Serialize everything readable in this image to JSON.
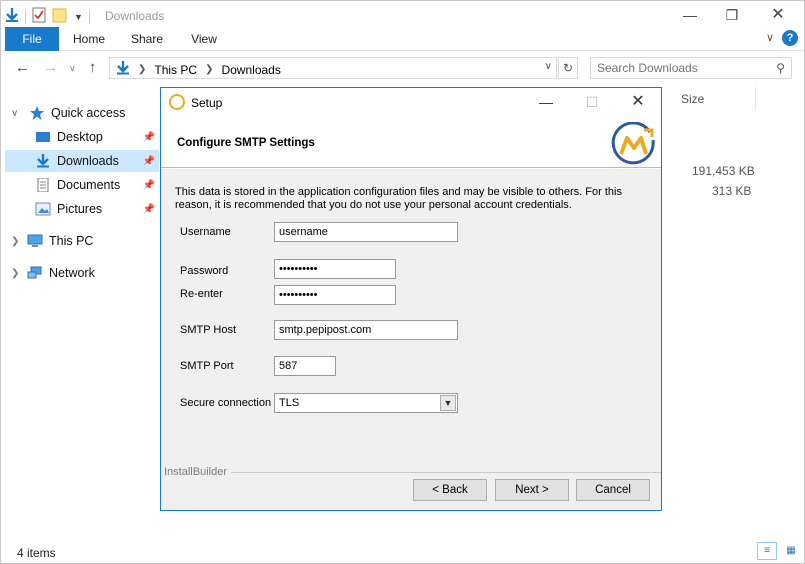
{
  "explorer": {
    "title": "Downloads",
    "ribbon_tabs": [
      "File",
      "Home",
      "Share",
      "View"
    ],
    "help_label": "?",
    "breadcrumb": [
      "This PC",
      "Downloads"
    ],
    "search_placeholder": "Search Downloads",
    "nav": {
      "quick_access": "Quick access",
      "items": [
        "Desktop",
        "Downloads",
        "Documents",
        "Pictures"
      ],
      "this_pc": "This PC",
      "network": "Network"
    },
    "columns": {
      "size": "Size"
    },
    "file_sizes": [
      "191,453 KB",
      "313 KB"
    ],
    "status": "4 items"
  },
  "dialog": {
    "title": "Setup",
    "heading": "Configure SMTP Settings",
    "notice": "This data is stored in the application configuration files and may be visible to others. For this reason, it is recommended that you do not use your personal account credentials.",
    "fields": {
      "username_label": "Username",
      "username_value": "username",
      "password_label": "Password",
      "password_value": "••••••••••",
      "reenter_label": "Re-enter",
      "reenter_value": "••••••••••",
      "host_label": "SMTP Host",
      "host_value": "smtp.pepipost.com",
      "port_label": "SMTP Port",
      "port_value": "587",
      "secure_label": "Secure connection",
      "secure_value": "TLS"
    },
    "footer_brand": "InstallBuilder",
    "buttons": {
      "back": "< Back",
      "next": "Next >",
      "cancel": "Cancel"
    }
  },
  "colors": {
    "accent": "#1979ca",
    "selected": "#cce8ff",
    "logo_orange": "#f0a823",
    "logo_blue": "#2c5aa0"
  }
}
